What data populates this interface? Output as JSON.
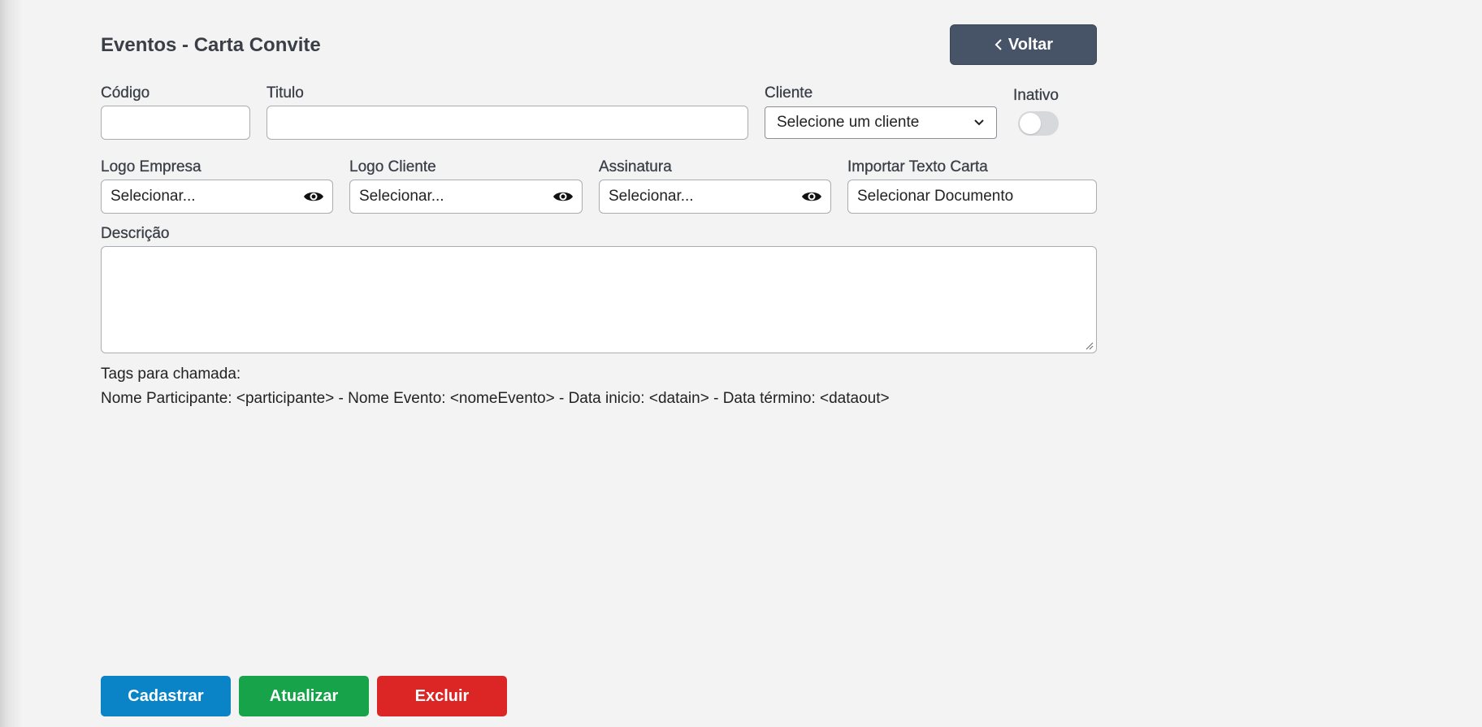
{
  "header": {
    "title": "Eventos - Carta Convite",
    "back_label": "Voltar"
  },
  "form": {
    "codigo": {
      "label": "Código",
      "value": ""
    },
    "titulo": {
      "label": "Titulo",
      "value": ""
    },
    "cliente": {
      "label": "Cliente",
      "selected": "Selecione um cliente"
    },
    "inativo": {
      "label": "Inativo",
      "checked": false
    },
    "logo_empresa": {
      "label": "Logo Empresa",
      "value": "Selecionar..."
    },
    "logo_cliente": {
      "label": "Logo Cliente",
      "value": "Selecionar..."
    },
    "assinatura": {
      "label": "Assinatura",
      "value": "Selecionar..."
    },
    "importar_texto": {
      "label": "Importar Texto Carta",
      "value": "Selecionar Documento"
    },
    "descricao": {
      "label": "Descrição",
      "value": ""
    }
  },
  "tags": {
    "title": "Tags para chamada:",
    "line": "Nome Participante: <participante> - Nome Evento: <nomeEvento> - Data inicio: <datain> - Data término: <dataout>"
  },
  "actions": {
    "cadastrar": "Cadastrar",
    "atualizar": "Atualizar",
    "excluir": "Excluir"
  },
  "colors": {
    "back_button": "#475467",
    "cadastrar": "#0a84c6",
    "atualizar": "#16a34a",
    "excluir": "#dc2626",
    "background": "#f3f3f3"
  }
}
